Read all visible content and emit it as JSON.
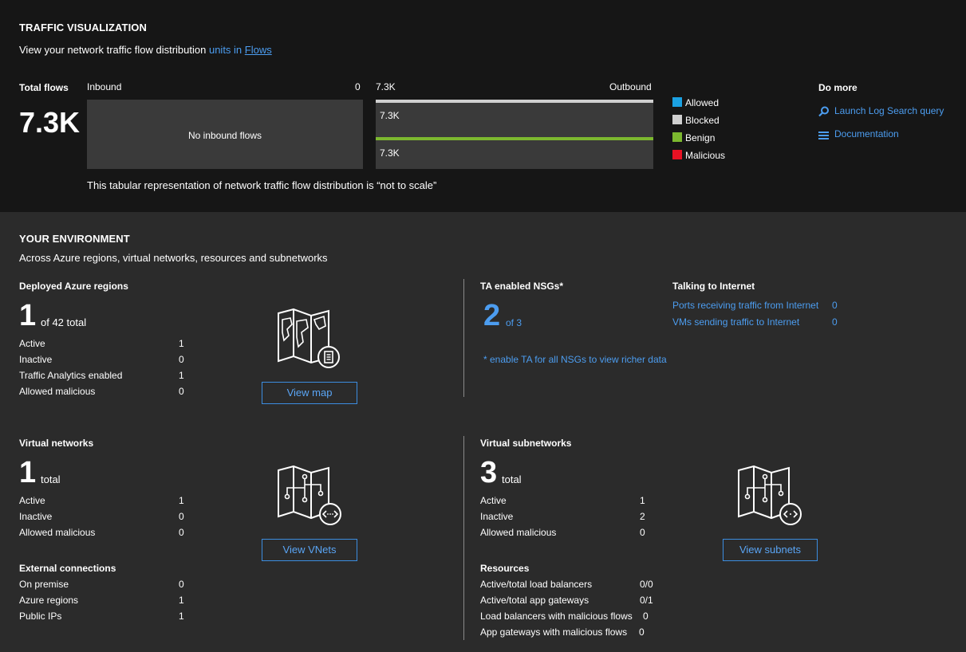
{
  "traffic": {
    "title": "TRAFFIC VISUALIZATION",
    "subtitle_prefix": "View your network traffic flow distribution",
    "subtitle_units": "units in",
    "subtitle_flows_link": "Flows",
    "total_label": "Total flows",
    "total_value": "7.3K",
    "inbound_label": "Inbound",
    "inbound_value": "0",
    "inbound_empty": "No inbound flows",
    "outbound_total_label": "7.3K",
    "outbound_label": "Outbound",
    "outbound_row1": "7.3K",
    "outbound_row2": "7.3K",
    "note": "This tabular representation of network traffic flow distribution is “not to scale”",
    "legend": [
      {
        "label": "Allowed",
        "color": "#1ba1e2"
      },
      {
        "label": "Blocked",
        "color": "#d0d0d0"
      },
      {
        "label": "Benign",
        "color": "#7cb82f"
      },
      {
        "label": "Malicious",
        "color": "#e81123"
      }
    ],
    "do_more_title": "Do more",
    "do_more_links": [
      "Launch Log Search query",
      "Documentation"
    ]
  },
  "environment": {
    "title": "YOUR ENVIRONMENT",
    "subtitle": "Across Azure regions, virtual networks, resources and subnetworks",
    "regions": {
      "title": "Deployed Azure regions",
      "big": "1",
      "big_suffix": "of 42 total",
      "rows": [
        {
          "label": "Active",
          "value": "1"
        },
        {
          "label": "Inactive",
          "value": "0"
        },
        {
          "label": "Traffic Analytics enabled",
          "value": "1"
        },
        {
          "label": "Allowed malicious",
          "value": "0"
        }
      ],
      "button": "View map"
    },
    "nsgs": {
      "title": "TA enabled NSGs*",
      "big": "2",
      "big_suffix": "of 3",
      "note": "* enable TA for all NSGs to view richer data"
    },
    "internet": {
      "title": "Talking to Internet",
      "rows": [
        {
          "label": "Ports receiving traffic from Internet",
          "value": "0"
        },
        {
          "label": "VMs sending traffic to Internet",
          "value": "0"
        }
      ]
    },
    "vnets": {
      "title": "Virtual networks",
      "big": "1",
      "big_suffix": "total",
      "rows": [
        {
          "label": "Active",
          "value": "1"
        },
        {
          "label": "Inactive",
          "value": "0"
        },
        {
          "label": "Allowed malicious",
          "value": "0"
        }
      ],
      "button": "View VNets"
    },
    "external": {
      "title": "External connections",
      "rows": [
        {
          "label": "On premise",
          "value": "0"
        },
        {
          "label": "Azure regions",
          "value": "1"
        },
        {
          "label": "Public IPs",
          "value": "1"
        }
      ]
    },
    "subnets": {
      "title": "Virtual subnetworks",
      "big": "3",
      "big_suffix": "total",
      "rows": [
        {
          "label": "Active",
          "value": "1"
        },
        {
          "label": "Inactive",
          "value": "2"
        },
        {
          "label": "Allowed malicious",
          "value": "0"
        }
      ],
      "button": "View subnets"
    },
    "resources": {
      "title": "Resources",
      "rows": [
        {
          "label": "Active/total load balancers",
          "value": "0/0"
        },
        {
          "label": "Active/total app gateways",
          "value": "0/1"
        },
        {
          "label": "Load balancers with malicious flows",
          "value": "0"
        },
        {
          "label": "App gateways with malicious flows",
          "value": "0"
        }
      ]
    }
  }
}
